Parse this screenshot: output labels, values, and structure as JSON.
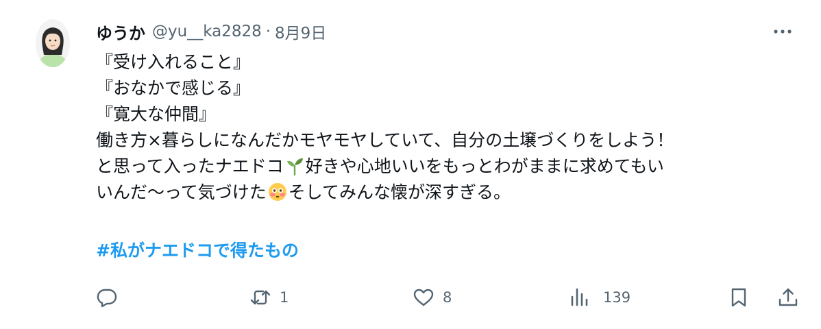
{
  "author": {
    "display_name": "ゆうか",
    "handle": "@yu__ka2828",
    "separator": "·",
    "date": "8月9日"
  },
  "body": {
    "line1": "『受け入れること』",
    "line2": "『おなかで感じる』",
    "line3": "『寛大な仲間』",
    "line4": "働き方×暮らしになんだかモヤモヤしていて、自分の土壌づくりをしよう！",
    "line5_before": "と思って入ったナエドコ",
    "line5_emoji": "seedling-emoji",
    "line5_after": "好きや心地いいをもっとわがままに求めてもい",
    "line6_before": "いんだ〜って気づけた",
    "line6_emoji": "flushed-face-emoji",
    "line6_after": "そしてみんな懐が深すぎる。"
  },
  "hashtag": "#私がナエドコで得たもの",
  "actions": {
    "reply": {
      "icon": "reply-icon",
      "count": ""
    },
    "retweet": {
      "icon": "retweet-icon",
      "count": "1"
    },
    "like": {
      "icon": "heart-icon",
      "count": "8"
    },
    "views": {
      "icon": "views-chart-icon",
      "count": "139"
    },
    "bookmark": {
      "icon": "bookmark-icon"
    },
    "share": {
      "icon": "share-icon"
    }
  },
  "more_icon": "more-options-icon",
  "colors": {
    "text": "#0f1419",
    "secondary": "#536471",
    "link": "#1d9bf0",
    "background": "#ffffff"
  }
}
